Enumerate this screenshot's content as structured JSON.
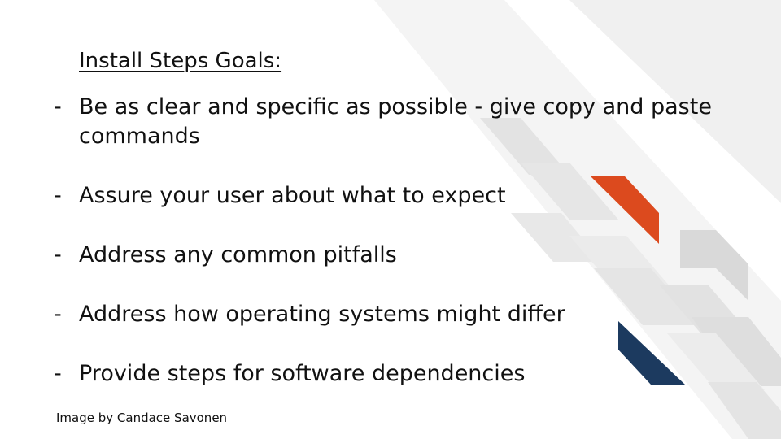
{
  "slide": {
    "title": "Install Steps Goals:",
    "bullet_marker": "-",
    "bullets": [
      "Be as clear and specific as possible - give copy and paste commands",
      "Assure your user about what to expect",
      "Address any common pitfalls",
      "Address how operating systems might differ",
      "Provide steps for software dependencies"
    ],
    "credit": "Image by Candace Savonen"
  },
  "colors": {
    "accent_orange": "#dc4a1e",
    "accent_navy": "#1c3a5f",
    "stripe_gray": "#e6e6e6"
  }
}
